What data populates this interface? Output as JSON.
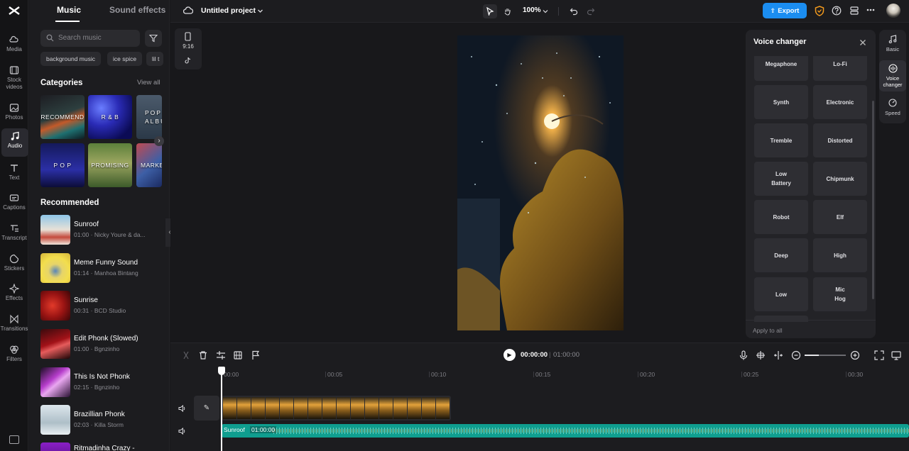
{
  "rail": {
    "items": [
      {
        "label": "Media",
        "icon": "media-icon"
      },
      {
        "label": "Stock videos",
        "icon": "stock-videos-icon"
      },
      {
        "label": "Photos",
        "icon": "photos-icon"
      },
      {
        "label": "Audio",
        "icon": "audio-icon"
      },
      {
        "label": "Text",
        "icon": "text-icon"
      },
      {
        "label": "Captions",
        "icon": "captions-icon"
      },
      {
        "label": "Transcript",
        "icon": "transcript-icon"
      },
      {
        "label": "Stickers",
        "icon": "stickers-icon"
      },
      {
        "label": "Effects",
        "icon": "effects-icon"
      },
      {
        "label": "Transitions",
        "icon": "transitions-icon"
      },
      {
        "label": "Filters",
        "icon": "filters-icon"
      }
    ],
    "active": "Audio"
  },
  "library": {
    "tabs": [
      "Music",
      "Sound effects"
    ],
    "search_placeholder": "Search music",
    "chips": [
      "background music",
      "ice spice",
      "lil t"
    ],
    "categories_title": "Categories",
    "view_all": "View all",
    "categories": [
      "RECOMMEND",
      "R & B",
      "POP ALBUM",
      "P O P",
      "PROMISING",
      "MARKE"
    ],
    "recommended_title": "Recommended",
    "tracks": [
      {
        "name": "Sunroof",
        "meta": "01:00 · Nicky Youre & da..."
      },
      {
        "name": "Meme Funny Sound",
        "meta": "01:14 · Manhoa Bintang"
      },
      {
        "name": "Sunrise",
        "meta": "00:31 · BCD Studio"
      },
      {
        "name": "Edit Phonk (Slowed)",
        "meta": "01:00 · Bgnzinho"
      },
      {
        "name": "This Is Not Phonk",
        "meta": "02:15 · Bgnzinho"
      },
      {
        "name": "Brazillian Phonk",
        "meta": "02:03 · Killa Storm"
      },
      {
        "name": "Ritmadinha Crazy -",
        "meta": ""
      }
    ]
  },
  "topbar": {
    "project_title": "Untitled project",
    "zoom": "100%",
    "export_label": "Export"
  },
  "stage": {
    "aspect_ratio": "9:16"
  },
  "voice_changer": {
    "title": "Voice changer",
    "options": [
      "Megaphone",
      "Lo-Fi",
      "Synth",
      "Electronic",
      "Tremble",
      "Distorted",
      "Low Battery",
      "Chipmunk",
      "Robot",
      "Elf",
      "Deep",
      "High",
      "Low",
      "Mic Hog"
    ],
    "apply_all": "Apply to all"
  },
  "right_rail": {
    "items": [
      "Basic",
      "Voice changer",
      "Speed"
    ],
    "active": "Voice changer"
  },
  "timeline": {
    "current_time": "00:00:00",
    "separator": "|",
    "duration": "01:00:00",
    "ticks": [
      "00:00",
      "00:05",
      "00:10",
      "00:15",
      "00:20",
      "00:25",
      "00:30"
    ],
    "audio_clip_name": "Sunroof",
    "audio_clip_time": "01:00:00",
    "zoom_level": 0.35
  },
  "colors": {
    "accent": "#1b8df0",
    "audio_track": "#0f9e8f",
    "background": "#18181b"
  }
}
